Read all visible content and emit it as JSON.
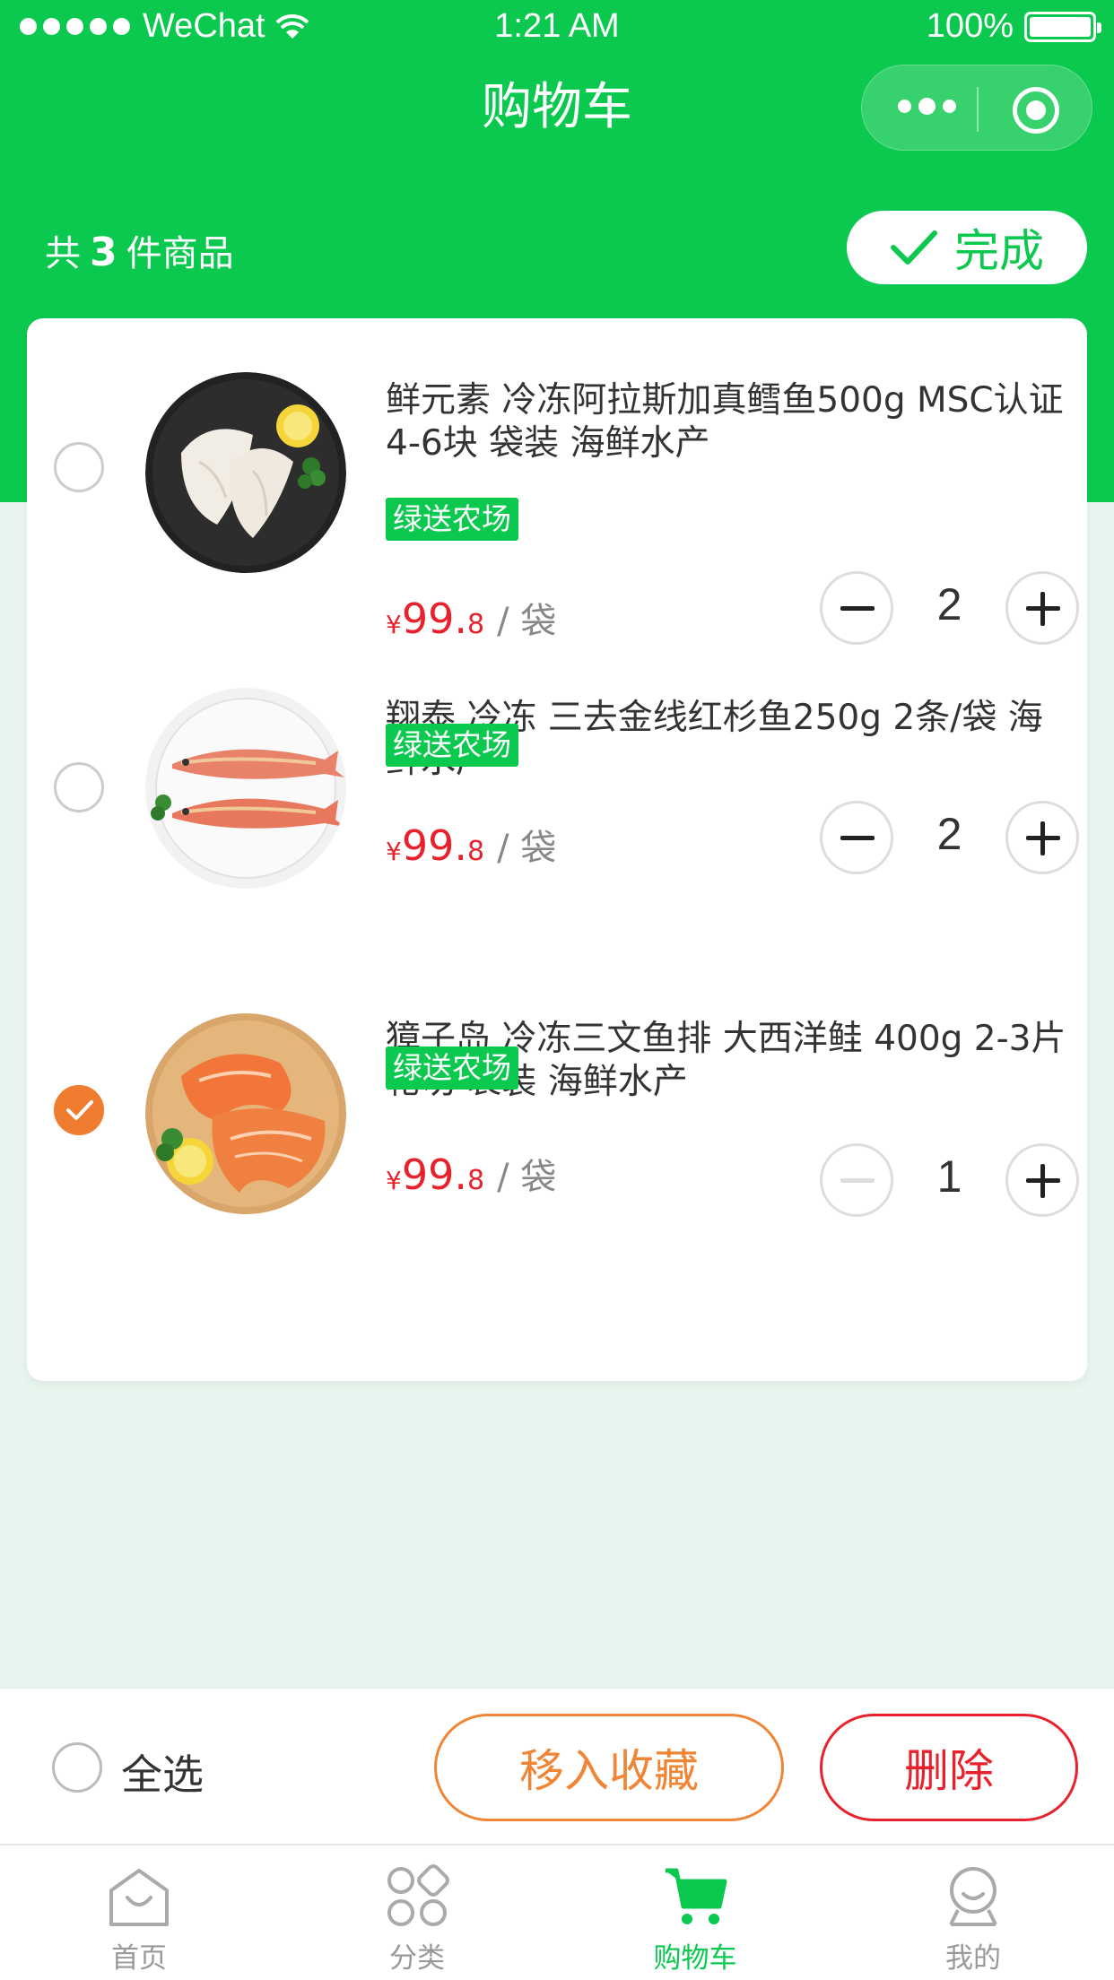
{
  "status_bar": {
    "carrier": "WeChat",
    "time": "1:21 AM",
    "battery": "100%"
  },
  "nav": {
    "title": "购物车"
  },
  "summary": {
    "prefix": "共",
    "count": "3",
    "suffix": "件商品",
    "done_label": "完成"
  },
  "items": [
    {
      "name": "鲜元素 冷冻阿拉斯加真鳕鱼500g MSC认证 4-6块 袋装 海鲜水产",
      "tag": "绿送农场",
      "price_symbol": "¥",
      "price_int": "99.",
      "price_dec": "8",
      "unit": "/ 袋",
      "quantity": "2",
      "selected": false,
      "image_icon": "cod-fish-plate-image"
    },
    {
      "name": "翔泰 冷冻 三去金线红杉鱼250g 2条/袋 海鲜水产",
      "tag": "绿送农场",
      "price_symbol": "¥",
      "price_int": "99.",
      "price_dec": "8",
      "unit": "/ 袋",
      "quantity": "2",
      "selected": false,
      "image_icon": "red-fish-plate-image"
    },
    {
      "name": "獐子岛 冷冻三文鱼排 大西洋鲑 400g 2-3片 轮切 袋装 海鲜水产",
      "tag": "绿送农场",
      "price_symbol": "¥",
      "price_int": "99.",
      "price_dec": "8",
      "unit": "/ 袋",
      "quantity": "1",
      "selected": true,
      "image_icon": "salmon-board-image"
    }
  ],
  "actions": {
    "select_all": "全选",
    "move_to_favorites": "移入收藏",
    "delete": "删除"
  },
  "tabs": [
    {
      "label": "首页",
      "icon": "home-icon",
      "active": false
    },
    {
      "label": "分类",
      "icon": "category-icon",
      "active": false
    },
    {
      "label": "购物车",
      "icon": "cart-icon",
      "active": true
    },
    {
      "label": "我的",
      "icon": "profile-icon",
      "active": false
    }
  ],
  "colors": {
    "brand_green": "#0bc84f",
    "price_red": "#e8222d",
    "accent_orange": "#f07c30"
  }
}
